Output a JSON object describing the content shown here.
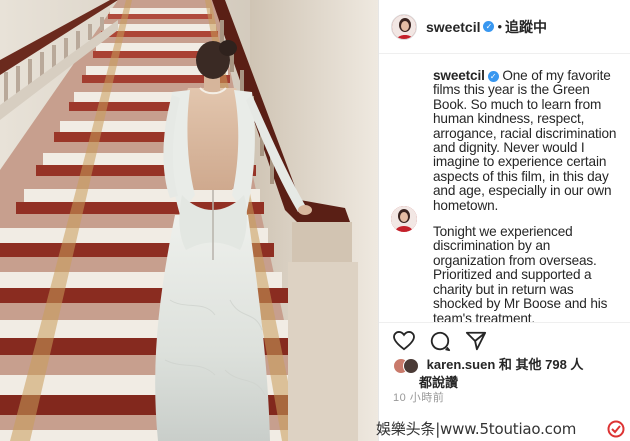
{
  "header": {
    "username": "sweetcil",
    "separator": "•",
    "follow_label": "追蹤中"
  },
  "caption": {
    "username": "sweetcil",
    "paragraph1": "One of my favorite films this year is the Green Book. So much to learn from human kindness, respect, arrogance, racial discrimination and dignity. Never would I imagine to experience certain aspects of this film, in this day and age, especially in our own hometown.",
    "paragraph2": "Tonight we experienced discrimination by an organization from overseas. Prioritized and supported a charity but in return was shocked by Mr Boose and his team's treatment."
  },
  "likes": {
    "user": "karen.suen",
    "rest": "和 其他 798 人",
    "line2": "都說讚"
  },
  "timestamp": "10 小時前",
  "watermark": "娛樂头条|www.5toutiao.com",
  "colors": {
    "verified": "#3897f0",
    "avatar_red": "#b02a2a",
    "text": "#262626",
    "muted": "#999999"
  },
  "icons": [
    "verified-icon",
    "heart-icon",
    "comment-icon",
    "share-icon",
    "watermark-logo-icon"
  ]
}
